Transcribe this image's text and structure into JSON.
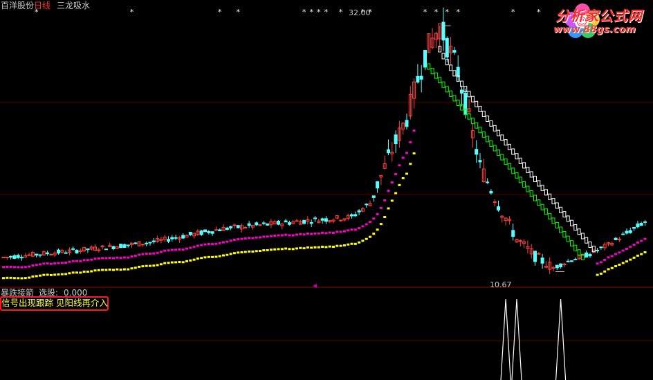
{
  "header": {
    "stock_name": "百洋股份",
    "period": "日线",
    "indicator": "三龙吸水"
  },
  "sub_panel": {
    "title": "暴跌接箭",
    "select_label": "选股:",
    "select_value": "0.000",
    "note": "信号出现跟踪 见阳线再介入"
  },
  "logo": {
    "name": "分析家公式网",
    "url": "www.88gs.com"
  },
  "colors": {
    "background": "#000000",
    "up_candle": "#ff4040",
    "down_candle": "#54ffff",
    "panel_divider": "#a00000",
    "ma_magenta": "#ff00cc",
    "ma_yellow": "#ffff00",
    "ma_white": "#ffffff",
    "ma_green": "#00ff00",
    "signal_line": "#ffffff",
    "note_text": "#ffff40",
    "note_border": "#ff1a1a"
  },
  "chart_data": {
    "type": "candlestick",
    "candle_count": 176,
    "y_range": [
      9.5,
      33
    ],
    "anchors": [
      [
        0,
        11.9
      ],
      [
        20,
        12.5
      ],
      [
        40,
        13.2
      ],
      [
        60,
        14.4
      ],
      [
        80,
        15.0
      ],
      [
        95,
        15.4
      ],
      [
        100,
        16.6
      ],
      [
        105,
        20.5
      ],
      [
        110,
        24.0
      ],
      [
        115,
        29.5
      ],
      [
        119,
        32.0
      ],
      [
        124,
        28.0
      ],
      [
        130,
        19.8
      ],
      [
        135,
        16.5
      ],
      [
        140,
        13.5
      ],
      [
        145,
        12.0
      ],
      [
        150,
        11.0
      ],
      [
        155,
        11.7
      ],
      [
        160,
        12.2
      ],
      [
        165,
        13.0
      ],
      [
        175,
        15.0
      ]
    ],
    "annotations": {
      "high_label": "32.00",
      "high_index": 119,
      "low_label": "10.67",
      "low_index": 150
    },
    "ma_lines": [
      {
        "color": "magenta",
        "offset": 0.93
      },
      {
        "color": "yellow",
        "offset": 0.85
      }
    ],
    "declining_line": {
      "colors": [
        "green",
        "white"
      ],
      "start_index": 116,
      "end_index": 158
    },
    "top_star_indices": [
      9,
      35,
      59,
      64,
      82,
      84,
      86,
      88,
      92,
      98,
      100,
      115,
      118,
      121,
      124,
      139,
      146,
      156
    ],
    "sub_spikes": [
      {
        "index": 137,
        "label": ""
      },
      {
        "index": 140,
        "label": ""
      },
      {
        "index": 152,
        "label": ""
      }
    ]
  }
}
